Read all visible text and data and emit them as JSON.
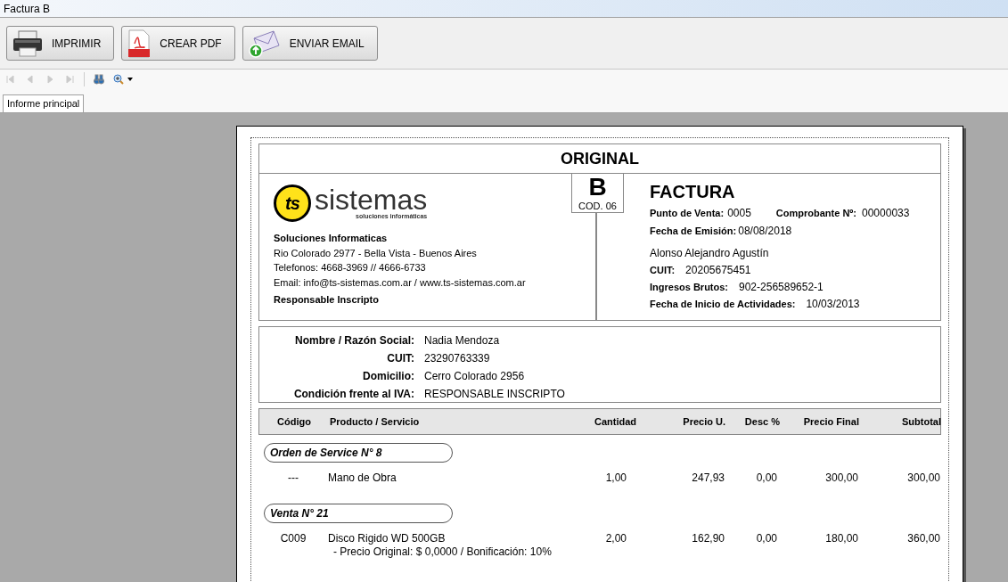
{
  "window": {
    "title": "Factura B"
  },
  "toolbar": [
    {
      "label": "IMPRIMIR",
      "kind": "printer"
    },
    {
      "label": "CREAR PDF",
      "kind": "pdf"
    },
    {
      "label": "ENVIAR EMAIL",
      "kind": "email"
    }
  ],
  "navigation": [
    {
      "kind": "first",
      "disabled": true
    },
    {
      "kind": "previous",
      "disabled": true
    },
    {
      "kind": "next",
      "disabled": true
    },
    {
      "kind": "last",
      "disabled": true
    },
    {
      "kind": "find",
      "disabled": false
    },
    {
      "kind": "zoom",
      "disabled": false
    }
  ],
  "tabs": [
    {
      "label": "Informe principal",
      "selected": true
    }
  ],
  "invoice": {
    "copy": "ORIGINAL",
    "letter": "B",
    "code": "COD. 06",
    "logo": {
      "name": "sistemas",
      "tagline": "soluciones informáticas",
      "mark": "ts"
    },
    "company": {
      "name": "Soluciones Informaticas",
      "lines": [
        "Rio Colorado 2977 - Bella Vista - Buenos Aires",
        "Telefonos: 4668-3969 // 4666-6733",
        "Email: info@ts-sistemas.com.ar / www.ts-sistemas.com.ar"
      ],
      "tax_status": "Responsable Inscripto"
    },
    "doc_title": "FACTURA",
    "point_of_sale": {
      "label": "Punto de Venta:",
      "value": "0005"
    },
    "number": {
      "label": "Comprobante Nº:",
      "value": "00000033"
    },
    "issue_date": {
      "label": "Fecha de Emisión:",
      "value": "08/08/2018"
    },
    "issuer": "Alonso Alejandro Agustín",
    "issuer_fields": [
      {
        "label": "CUIT:",
        "value": "20205675451"
      },
      {
        "label": "Ingresos Brutos:",
        "value": "902-256589652-1"
      },
      {
        "label": "Fecha de Inicio de Actividades:",
        "value": "10/03/2013"
      }
    ],
    "customer": [
      {
        "label": "Nombre / Razón Social:",
        "value": "Nadia Mendoza"
      },
      {
        "label": "CUIT:",
        "value": "23290763339"
      },
      {
        "label": "Domicilio:",
        "value": "Cerro Colorado 2956"
      },
      {
        "label": "Condición frente al IVA:",
        "value": "RESPONSABLE INSCRIPTO"
      }
    ],
    "columns": [
      "Código",
      "Producto / Servicio",
      "Cantidad",
      "Precio U.",
      "Desc %",
      "Precio Final",
      "Subtotal"
    ],
    "groups": [
      {
        "title": "Orden de Service N° 8",
        "rows": [
          {
            "cells": [
              "---",
              "Mano de Obra",
              "1,00",
              "247,93",
              "0,00",
              "300,00",
              "300,00"
            ]
          }
        ]
      },
      {
        "title": "Venta N° 21",
        "rows": [
          {
            "cells": [
              "C009",
              "Disco Rigido WD 500GB",
              "2,00",
              "162,90",
              "0,00",
              "180,00",
              "360,00"
            ],
            "note": "- Precio Original: $ 0,0000 / Bonificación: 10%"
          }
        ]
      }
    ]
  }
}
